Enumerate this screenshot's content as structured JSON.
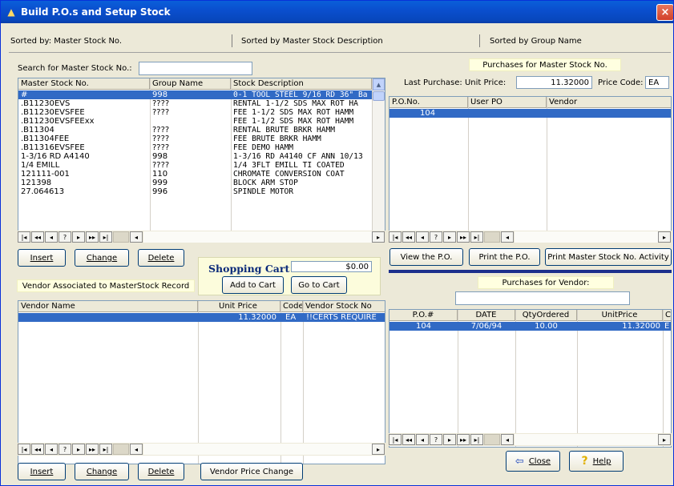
{
  "window": {
    "title": "Build P.O.s and Setup Stock",
    "close": "×"
  },
  "sort_tabs": {
    "sorted_by_no": "Sorted by:  Master Stock No.",
    "sorted_by_desc": "Sorted by Master Stock Description",
    "sorted_by_group": "Sorted by Group Name"
  },
  "search": {
    "label": "Search for Master Stock No.:",
    "value": ""
  },
  "master_grid": {
    "headers": [
      "Master Stock No.",
      "Group Name",
      "Stock Description"
    ],
    "rows": [
      [
        "#",
        "998",
        "0-1 TOOL STEEL 9/16 RD 36\" Ba"
      ],
      [
        ".B11230EVS",
        "????",
        "RENTAL 1-1/2 SDS MAX ROT HA"
      ],
      [
        ".B11230EVSFEE",
        "????",
        "FEE 1-1/2 SDS MAX ROT HAMM"
      ],
      [
        ".B11230EVSFEExx",
        "",
        "FEE 1-1/2 SDS MAX ROT HAMM"
      ],
      [
        ".B11304",
        "????",
        "RENTAL BRUTE BRKR HAMM"
      ],
      [
        ".B11304FEE",
        "????",
        "FEE BRUTE BRKR HAMM"
      ],
      [
        ".B11316EVSFEE",
        "????",
        "FEE DEMO HAMM"
      ],
      [
        "1-3/16 RD A4140",
        "998",
        "1-3/16 RD A4140 CF ANN 10/13"
      ],
      [
        "1/4 EMILL",
        "????",
        "1/4 3FLT EMILL TI COATED"
      ],
      [
        "121111-001",
        "110",
        "CHROMATE CONVERSION COAT"
      ],
      [
        "121398",
        "999",
        "BLOCK ARM STOP"
      ],
      [
        "27.064613",
        "996",
        "SPINDLE MOTOR"
      ]
    ]
  },
  "nav": [
    "|◂",
    "◂◂",
    "◂",
    "?",
    "▸",
    "▸▸",
    "▸|",
    "◂"
  ],
  "master_buttons": {
    "insert": "Insert",
    "change": "Change",
    "delete": "Delete"
  },
  "cart": {
    "title": "Shopping Cart",
    "total": "$0.00",
    "add": "Add to Cart",
    "goto": "Go to Cart"
  },
  "vendor_assoc_label": "Vendor Associated to MasterStock Record",
  "vendor_grid": {
    "headers": [
      "Vendor Name",
      "Unit Price",
      "Code",
      "Vendor Stock No"
    ],
    "rows": [
      [
        "",
        "11.32000",
        "EA",
        "!!CERTS REQUIRE"
      ]
    ]
  },
  "vendor_buttons": {
    "insert": "Insert",
    "change": "Change",
    "delete": "Delete",
    "price_change": "Vendor Price Change"
  },
  "purchases_master": {
    "title": "Purchases for Master Stock No.",
    "last_purchase_label": "Last Purchase:  Unit Price:",
    "unit_price": "11.32000",
    "price_code_label": "Price Code:",
    "price_code": "EA",
    "headers": [
      "P.O.No.",
      "User PO",
      "Vendor"
    ],
    "rows": [
      [
        "104",
        "",
        ""
      ]
    ]
  },
  "po_buttons": {
    "view": "View the P.O.",
    "print": "Print the P.O.",
    "activity": "Print Master Stock No. Activity"
  },
  "purchases_vendor": {
    "title": "Purchases for Vendor:",
    "vendor_value": "",
    "headers": [
      "P.O.#",
      "DATE",
      "QtyOrdered",
      "UnitPrice",
      "C"
    ],
    "rows": [
      [
        "104",
        "7/06/94",
        "10.00",
        "11.32000",
        "E"
      ]
    ]
  },
  "bottom_buttons": {
    "close": "Close",
    "help": "Help"
  }
}
